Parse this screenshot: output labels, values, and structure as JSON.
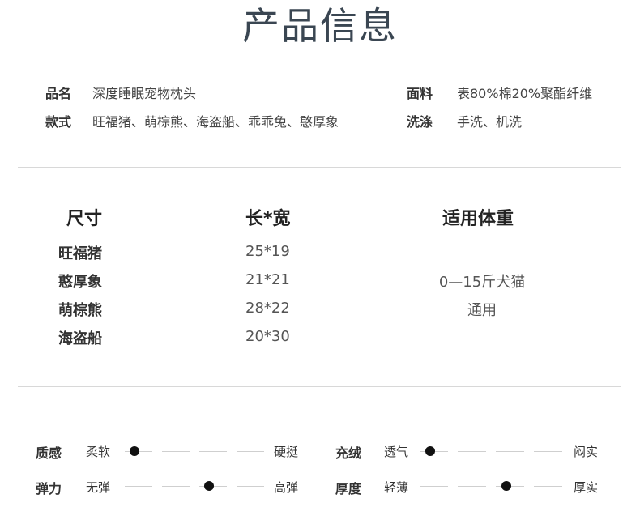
{
  "title": "产品信息",
  "info": {
    "name_label": "品名",
    "name_value": "深度睡眠宠物枕头",
    "style_label": "款式",
    "style_value": "旺福猪、萌棕熊、海盗船、乖乖兔、憨厚象",
    "fabric_label": "面料",
    "fabric_value": "表80%棉20%聚酯纤维",
    "wash_label": "洗涤",
    "wash_value": "手洗、机洗"
  },
  "size_table": {
    "headers": [
      "尺寸",
      "长*宽",
      "适用体重"
    ],
    "rows": [
      {
        "name": "旺福猪",
        "size": "25*19"
      },
      {
        "name": "憨厚象",
        "size": "21*21"
      },
      {
        "name": "萌棕熊",
        "size": "28*22"
      },
      {
        "name": "海盗船",
        "size": "20*30"
      }
    ],
    "weight_line1": "0—15斤犬猫",
    "weight_line2": "通用"
  },
  "attributes": [
    {
      "label": "质感",
      "left": "柔软",
      "right": "硬挺",
      "level": 1,
      "steps": 5
    },
    {
      "label": "充绒",
      "left": "透气",
      "right": "闷实",
      "level": 1,
      "steps": 5
    },
    {
      "label": "弹力",
      "left": "无弹",
      "right": "高弹",
      "level": 3,
      "steps": 5
    },
    {
      "label": "厚度",
      "left": "轻薄",
      "right": "厚实",
      "level": 3,
      "steps": 5
    }
  ]
}
